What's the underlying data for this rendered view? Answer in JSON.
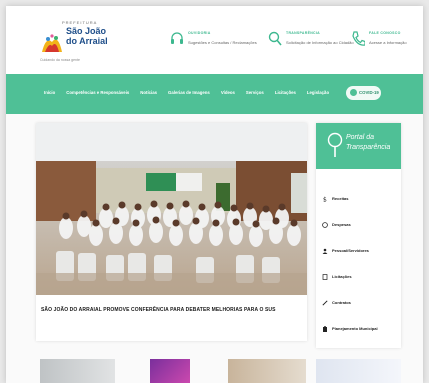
{
  "header": {
    "logo": {
      "prefix": "PREFEITURA",
      "name_line1": "São João",
      "name_line2": "do Arraial",
      "slogan": "Cuidando da nossa gente"
    },
    "items": [
      {
        "title": "OUVIDORIA",
        "subtitle": "Sugestões e Consultas / Reclamações",
        "icon": "headset-icon"
      },
      {
        "title": "TRANSPARÊNCIA",
        "subtitle": "Solicitação de Informação ao Cidadão",
        "icon": "search-icon"
      },
      {
        "title": "FALE CONOSCO",
        "subtitle": "Acesse a Informação",
        "icon": "phone-icon"
      }
    ]
  },
  "nav": {
    "items": [
      "Início",
      "Competências e Responsáveis",
      "Notícias",
      "Galerias de Imagens",
      "Vídeos",
      "Serviços",
      "Licitações",
      "Legislação"
    ],
    "covid_label": "COVID-19"
  },
  "main": {
    "headline": "SÃO JOÃO DO ARRAIAL PROMOVE CONFERÊNCIA PARA DEBATER MELHORIAS PARA O SUS"
  },
  "sidebar": {
    "portal_title1": "Portal da",
    "portal_title2": "Transparência",
    "items": [
      {
        "label": "Receitas",
        "icon": "dollar-icon"
      },
      {
        "label": "Despesas",
        "icon": "money-icon"
      },
      {
        "label": "Pessoal/Servidores",
        "icon": "user-icon"
      },
      {
        "label": "Licitações",
        "icon": "document-icon"
      },
      {
        "label": "Contratos",
        "icon": "pen-icon"
      },
      {
        "label": "Planejamento Municipal",
        "icon": "clipboard-icon"
      }
    ]
  },
  "colors": {
    "accent": "#4fc096",
    "brand": "#1f4f8a"
  }
}
